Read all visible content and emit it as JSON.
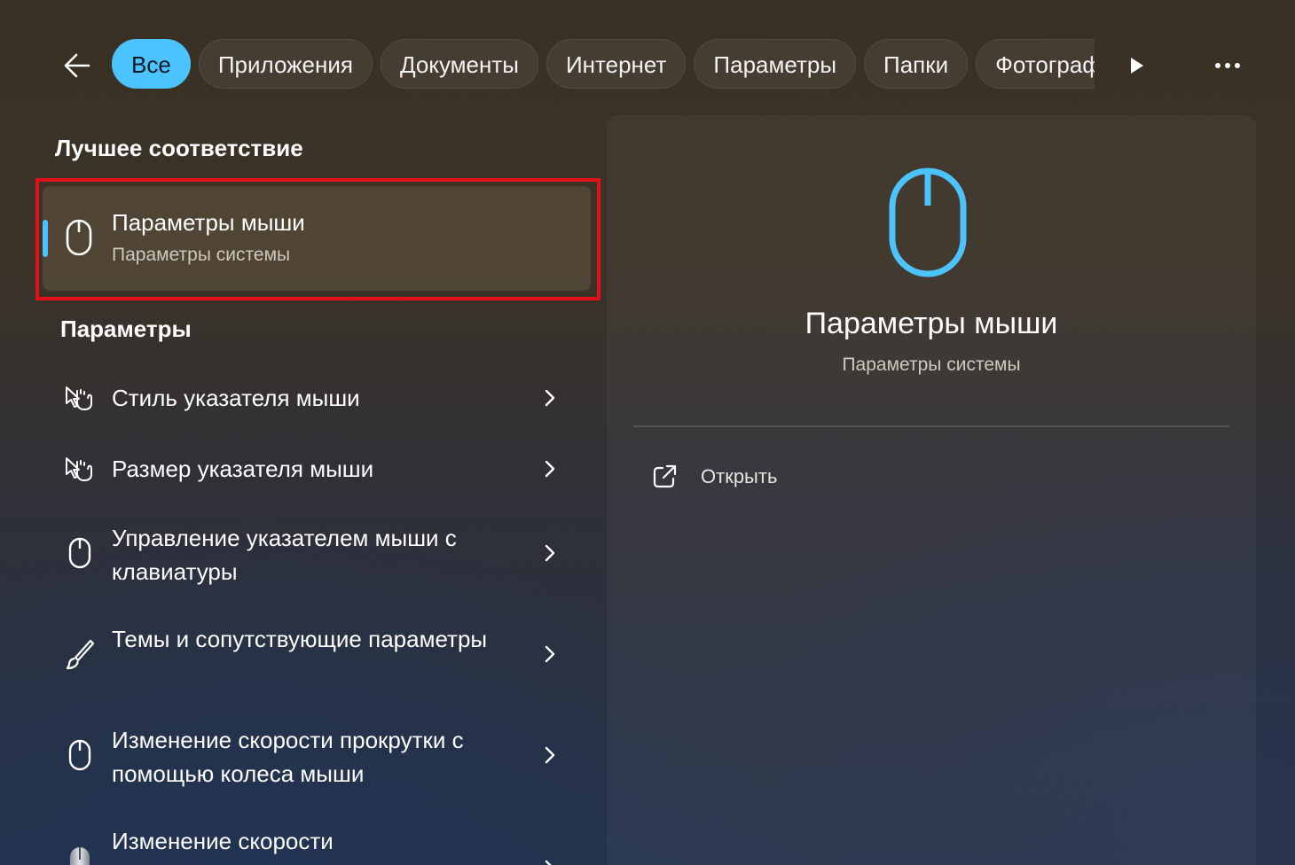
{
  "filters": {
    "back_icon": "arrow-left-icon",
    "items": [
      {
        "label": "Все",
        "active": true
      },
      {
        "label": "Приложения",
        "active": false
      },
      {
        "label": "Документы",
        "active": false
      },
      {
        "label": "Интернет",
        "active": false
      },
      {
        "label": "Параметры",
        "active": false
      },
      {
        "label": "Папки",
        "active": false
      },
      {
        "label": "Фотографии",
        "active": false
      }
    ],
    "scroll_icon": "play-right-icon",
    "more_icon": "more-horizontal-icon"
  },
  "best_match": {
    "section_title": "Лучшее соответствие",
    "item": {
      "title": "Параметры мыши",
      "subtitle": "Параметры системы",
      "icon": "mouse-icon"
    }
  },
  "settings_section": {
    "title": "Параметры",
    "items": [
      {
        "label": "Стиль указателя мыши",
        "icon": "mouse-pointer-style-icon"
      },
      {
        "label": "Размер указателя мыши",
        "icon": "mouse-pointer-style-icon"
      },
      {
        "label": "Управление указателем мыши с клавиатуры",
        "icon": "mouse-icon"
      },
      {
        "label": "Темы и сопутствующие параметры",
        "icon": "brush-icon"
      },
      {
        "label": "Изменение скорости прокрутки с помощью колеса мыши",
        "icon": "mouse-icon"
      },
      {
        "label": "Изменение скорости",
        "icon": "mouse-device-icon"
      }
    ]
  },
  "preview": {
    "icon": "mouse-icon",
    "title": "Параметры мыши",
    "subtitle": "Параметры системы",
    "actions": [
      {
        "label": "Открыть",
        "icon": "open-external-icon"
      }
    ]
  },
  "colors": {
    "accent": "#4cc2ff",
    "highlight": "#e3101b"
  }
}
